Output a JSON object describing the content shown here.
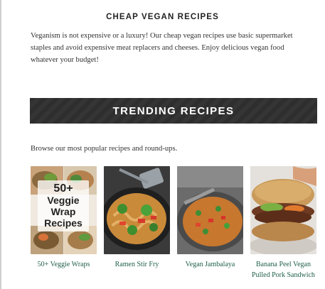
{
  "section": {
    "title": "CHEAP VEGAN RECIPES",
    "intro": "Veganism is not expensive or a luxury! Our cheap vegan recipes use basic supermarket staples and avoid expensive meat replacers and cheeses. Enjoy delicious vegan food whatever your budget!"
  },
  "trending": {
    "title": "TRENDING RECIPES",
    "subtitle": "Browse our most popular recipes and round-ups."
  },
  "cards": [
    {
      "caption": "50+ Veggie Wraps",
      "overlay_lines": [
        "50+",
        "Veggie",
        "Wrap",
        "Recipes"
      ]
    },
    {
      "caption": "Ramen Stir Fry"
    },
    {
      "caption": "Vegan Jambalaya"
    },
    {
      "caption": "Banana Peel Vegan Pulled Pork Sandwich"
    }
  ],
  "colors": {
    "bar": "#2e2e2e",
    "caption": "#1f5e4a",
    "text": "#333333"
  }
}
